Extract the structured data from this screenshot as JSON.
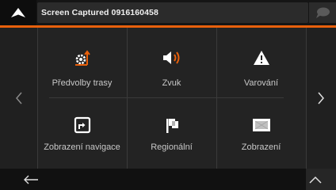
{
  "header": {
    "title": "Screen Captured 0916160458"
  },
  "menu": {
    "items": [
      {
        "label": "Předvolby trasy",
        "icon": "route-settings-icon"
      },
      {
        "label": "Zvuk",
        "icon": "speaker-icon"
      },
      {
        "label": "Varování",
        "icon": "warning-icon"
      },
      {
        "label": "Zobrazení navigace",
        "icon": "navigation-view-icon"
      },
      {
        "label": "Regionální",
        "icon": "flag-icon"
      },
      {
        "label": "Zobrazení",
        "icon": "display-icon"
      }
    ]
  },
  "colors": {
    "accent": "#e8600c",
    "background": "#232323"
  }
}
